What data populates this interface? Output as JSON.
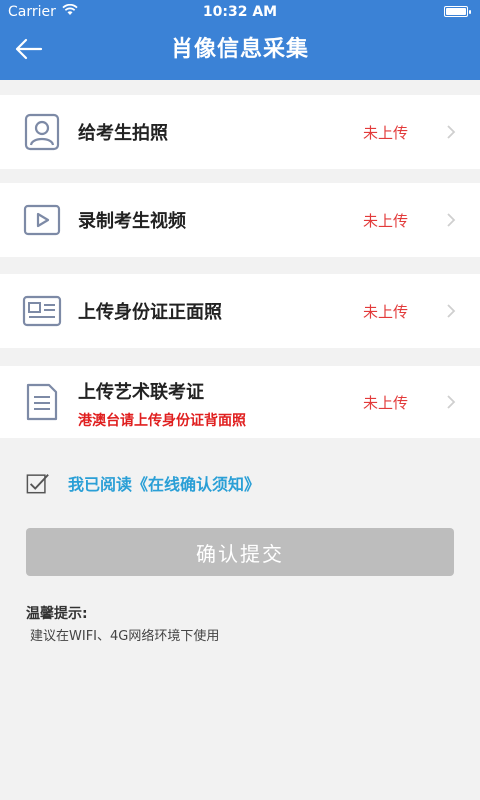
{
  "status_bar": {
    "carrier": "Carrier",
    "time": "10:32 AM"
  },
  "header": {
    "title": "肖像信息采集",
    "back_icon": "arrow-left-icon"
  },
  "items": [
    {
      "label": "给考生拍照",
      "status": "未上传",
      "icon": "person-icon"
    },
    {
      "label": "录制考生视频",
      "status": "未上传",
      "icon": "video-play-icon"
    },
    {
      "label": "上传身份证正面照",
      "status": "未上传",
      "icon": "id-card-icon"
    },
    {
      "label": "上传艺术联考证",
      "sub": "港澳台请上传身份证背面照",
      "status": "未上传",
      "icon": "document-icon"
    }
  ],
  "agreement": {
    "checked": true,
    "text": "我已阅读《在线确认须知》"
  },
  "submit": {
    "label": "确认提交",
    "disabled": true
  },
  "tips": {
    "title": "温馨提示:",
    "text": "建议在WIFI、4G网络环境下使用"
  },
  "colors": {
    "header": "#3b82d6",
    "status_red": "#e23a3a",
    "link_blue": "#2a9fd6",
    "button_disabled": "#bdbdbd"
  }
}
